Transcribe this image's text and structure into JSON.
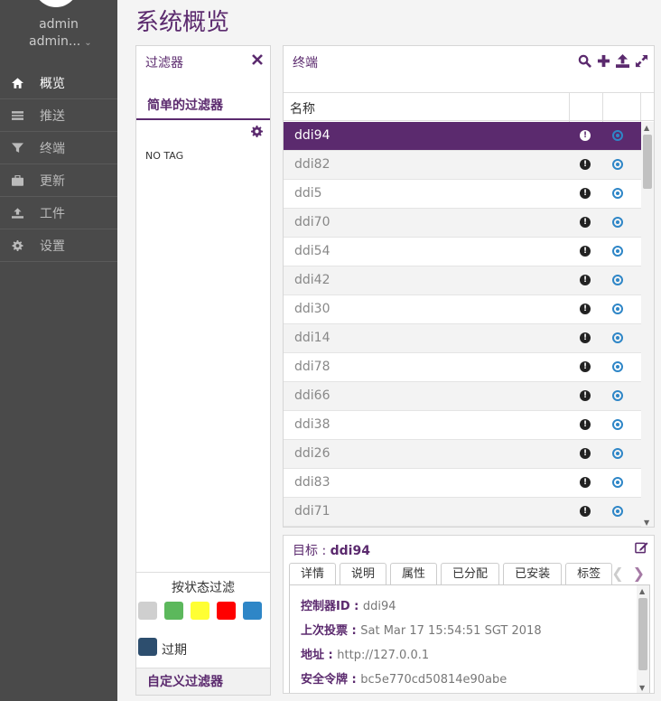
{
  "user": {
    "name": "admin",
    "role": "admin..."
  },
  "sidebar": {
    "items": [
      {
        "label": "概览",
        "icon": "home-icon",
        "active": true
      },
      {
        "label": "推送",
        "icon": "list-icon",
        "active": false
      },
      {
        "label": "终端",
        "icon": "filter-icon",
        "active": false
      },
      {
        "label": "更新",
        "icon": "briefcase-icon",
        "active": false
      },
      {
        "label": "工件",
        "icon": "upload-icon",
        "active": false
      },
      {
        "label": "设置",
        "icon": "gear-icon",
        "active": false
      }
    ]
  },
  "page": {
    "title": "系统概览"
  },
  "filters": {
    "title": "过滤器",
    "simple_title": "简单的过滤器",
    "no_tag": "NO TAG",
    "status_title": "按状态过滤",
    "status_colors": [
      "#cfcfcf",
      "#5cb85c",
      "#ffff33",
      "#ff0000",
      "#2e86c7"
    ],
    "expired_label": "过期",
    "custom_title": "自定义过滤器"
  },
  "terminals": {
    "title": "终端",
    "column_name": "名称",
    "rows": [
      {
        "name": "ddi94",
        "selected": true
      },
      {
        "name": "ddi82",
        "selected": false
      },
      {
        "name": "ddi5",
        "selected": false
      },
      {
        "name": "ddi70",
        "selected": false
      },
      {
        "name": "ddi54",
        "selected": false
      },
      {
        "name": "ddi42",
        "selected": false
      },
      {
        "name": "ddi30",
        "selected": false
      },
      {
        "name": "ddi14",
        "selected": false
      },
      {
        "name": "ddi78",
        "selected": false
      },
      {
        "name": "ddi66",
        "selected": false
      },
      {
        "name": "ddi38",
        "selected": false
      },
      {
        "name": "ddi26",
        "selected": false
      },
      {
        "name": "ddi83",
        "selected": false
      },
      {
        "name": "ddi71",
        "selected": false
      }
    ]
  },
  "detail": {
    "title_prefix": "目标 : ",
    "target_name": "ddi94",
    "tabs": [
      "详情",
      "说明",
      "属性",
      "已分配",
      "已安装",
      "标签"
    ],
    "fields": [
      {
        "label": "控制器ID : ",
        "value": "ddi94"
      },
      {
        "label": "上次投票 : ",
        "value": "Sat Mar 17 15:54:51 SGT 2018"
      },
      {
        "label": "地址 : ",
        "value": "http://127.0.0.1"
      },
      {
        "label": "安全令牌 : ",
        "value": "bc5e770cd50814e90abe"
      }
    ]
  },
  "colors": {
    "accent": "#5b2a6e",
    "sidebar_bg": "#4a4a4a",
    "status_blue": "#2e86c7"
  }
}
